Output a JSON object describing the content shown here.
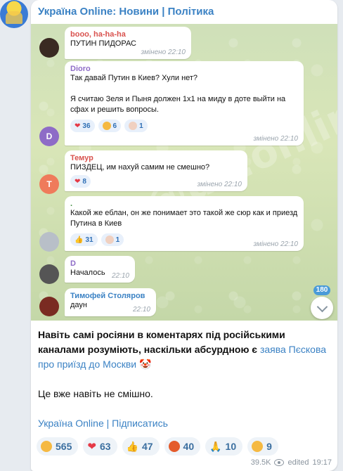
{
  "channel": {
    "title": "Україна Online: Новини | Політика"
  },
  "comments": [
    {
      "name": "booo, ha-ha-ha",
      "name_color": "#d9534f",
      "text": "ПУТИН ПИДОРАС",
      "time": "змінено 22:10"
    },
    {
      "name": "Dioro",
      "name_color": "#8e6cc7",
      "avatar_letter": "D",
      "text": "Так давай Путин в Киев? Хули нет?\n\nЯ считаю Зеля и Пыня должен 1х1 на миду в доте выйти на сфах и решить вопросы.",
      "time": "змінено 22:10",
      "reactions": [
        {
          "icon": "heart",
          "count": "36"
        },
        {
          "icon": "laugh",
          "count": "6"
        },
        {
          "icon": "clown",
          "count": "1"
        }
      ]
    },
    {
      "name": "Темур",
      "name_color": "#d9534f",
      "avatar_letter": "Т",
      "text": "ПИЗДЕЦ, им нахуй самим не смешно?",
      "time": "змінено 22:10",
      "reactions": [
        {
          "icon": "heart",
          "count": "8"
        }
      ]
    },
    {
      "name": ".",
      "name_color": "#3a8a3a",
      "text": "Какой же еблан, он же понимает это такой же сюр как и приезд Путина в Киев",
      "time": "змінено 22:10",
      "reactions": [
        {
          "icon": "thumbs-up",
          "count": "31"
        },
        {
          "icon": "clown",
          "count": "1"
        }
      ]
    },
    {
      "name": "D",
      "name_color": "#8e6cc7",
      "text": "Началось",
      "time": "22:10"
    },
    {
      "name": "Тимофей Столяров",
      "name_color": "#3b82c4",
      "text": "даун",
      "time": "22:10"
    }
  ],
  "scroll": {
    "unread_count": "180"
  },
  "post": {
    "text_before_link": "Навіть самі росіяни в коментарях під російськими каналами розуміють, наскільки абсурдною є ",
    "link_text": "заява Пєскова про приїзд до Москви",
    "text_after_link": " 🤡",
    "line2": "Це вже навіть не смішно.",
    "subscribe_link": "Україна Online | Підписатись"
  },
  "reactions": [
    {
      "icon": "laugh",
      "count": "565",
      "color": "#f5b942"
    },
    {
      "icon": "heart",
      "count": "63",
      "color": "#e53946"
    },
    {
      "icon": "thumbs-up",
      "count": "47",
      "color": "#f2b33d"
    },
    {
      "icon": "angry",
      "count": "40",
      "color": "#e45b2b"
    },
    {
      "icon": "pray",
      "count": "10",
      "color": "#f2b33d"
    },
    {
      "icon": "cry",
      "count": "9",
      "color": "#f5b942"
    }
  ],
  "meta": {
    "views": "39.5K",
    "edited": "edited",
    "time": "19:17"
  }
}
